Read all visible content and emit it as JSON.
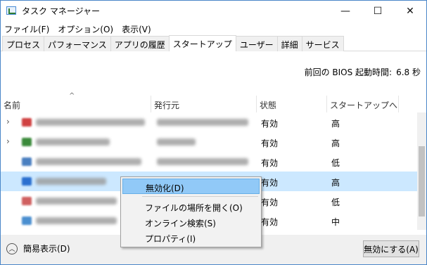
{
  "window": {
    "title": "タスク マネージャー",
    "minimize": "—",
    "maximize": "☐",
    "close": "✕"
  },
  "menu": [
    "ファイル(F)",
    "オプション(O)",
    "表示(V)"
  ],
  "tabs": [
    "プロセス",
    "パフォーマンス",
    "アプリの履歴",
    "スタートアップ",
    "ユーザー",
    "詳細",
    "サービス"
  ],
  "active_tab": "スタートアップ",
  "bios": {
    "label": "前回の BIOS 起動時間:",
    "value": "6.8 秒"
  },
  "columns": {
    "name": "名前",
    "publisher": "発行元",
    "status": "状態",
    "impact": "スタートアップへ..."
  },
  "rows": [
    {
      "expandable": true,
      "status": "有効",
      "impact": "高",
      "icon_color": "#d04040"
    },
    {
      "expandable": true,
      "status": "有効",
      "impact": "高",
      "icon_color": "#3b8a3b"
    },
    {
      "expandable": false,
      "status": "有効",
      "impact": "低",
      "icon_color": "#4a7fc0"
    },
    {
      "expandable": false,
      "status": "有効",
      "impact": "高",
      "icon_color": "#2a6fd0",
      "selected": true
    },
    {
      "expandable": false,
      "status": "有効",
      "impact": "低",
      "icon_color": "#d06060"
    },
    {
      "expandable": false,
      "status": "有効",
      "impact": "中",
      "icon_color": "#4a8fd0"
    }
  ],
  "context_menu": {
    "disable": "無効化(D)",
    "open_location": "ファイルの場所を開く(O)",
    "search_online": "オンライン検索(S)",
    "properties": "プロパティ(I)"
  },
  "footer": {
    "fewer_details": "簡易表示(D)",
    "disable_button": "無効にする(A)"
  },
  "colors": {
    "selection": "#cce8ff",
    "menu_highlight": "#91c9f7"
  }
}
